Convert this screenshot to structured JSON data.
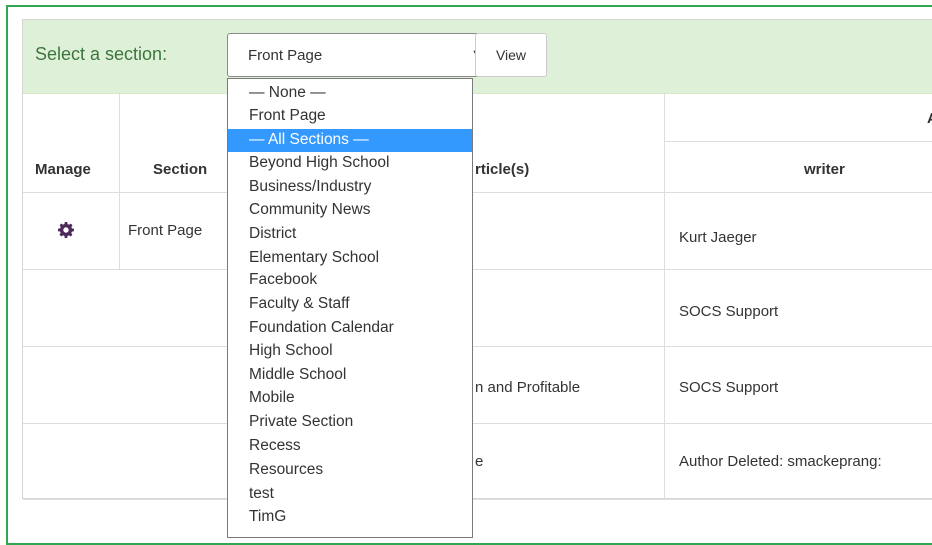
{
  "filter": {
    "label": "Select a section:",
    "selected_value": "Front Page",
    "view_button": "View"
  },
  "dropdown": {
    "highlighted": "— All Sections —",
    "options": [
      "— None —",
      "Front Page",
      "— All Sections —",
      "Beyond High School",
      "Business/Industry",
      "Community News",
      "District",
      "Elementary School",
      "Facebook",
      "Faculty & Staff",
      "Foundation Calendar",
      "High School",
      "Middle School",
      "Mobile",
      "Private Section",
      "Recess",
      "Resources",
      "test",
      "TimG"
    ]
  },
  "table": {
    "headers": {
      "manage": "Manage",
      "section": "Section",
      "articles": "rticle(s)",
      "group_partial": "A",
      "writer": "writer"
    },
    "rows": [
      {
        "section": "Front Page",
        "article": "",
        "writer": "Kurt Jaeger",
        "manage_icon": "gear-icon"
      },
      {
        "section": "",
        "article": "",
        "writer": "SOCS Support"
      },
      {
        "section": "",
        "article": "n and Profitable",
        "writer": "SOCS Support"
      },
      {
        "section": "",
        "article": "e",
        "writer": "Author Deleted: smackeprang:"
      }
    ]
  },
  "colors": {
    "header_bg": "#dff0d8",
    "label_green": "#3c763d",
    "frame_green": "#2fa84f",
    "highlight_blue": "#3399ff",
    "gear_purple": "#4e2a5a"
  }
}
